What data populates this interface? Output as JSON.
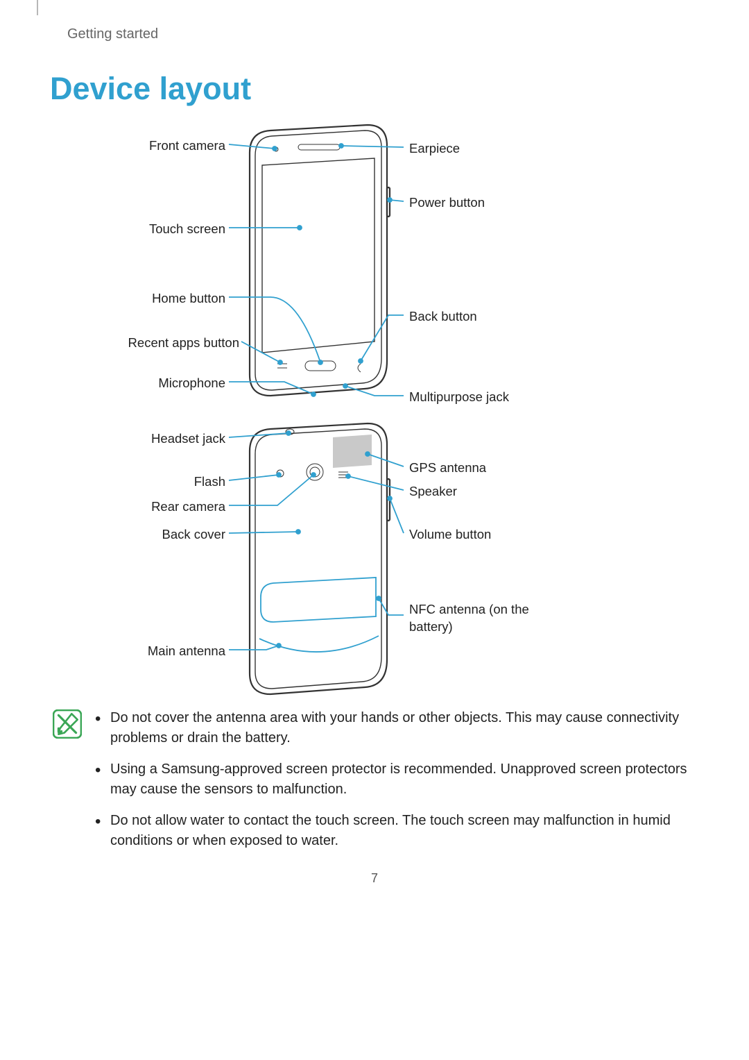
{
  "running_head": "Getting started",
  "title": "Device layout",
  "page_number": "7",
  "labels": {
    "front_camera": "Front camera",
    "touch_screen": "Touch screen",
    "home_button": "Home button",
    "recent_apps": "Recent apps button",
    "microphone": "Microphone",
    "earpiece": "Earpiece",
    "power_button": "Power button",
    "back_button": "Back button",
    "multi_jack": "Multipurpose jack",
    "headset_jack": "Headset jack",
    "flash": "Flash",
    "rear_camera": "Rear camera",
    "back_cover": "Back cover",
    "main_antenna": "Main antenna",
    "gps_antenna": "GPS antenna",
    "speaker": "Speaker",
    "volume_button": "Volume button",
    "nfc_antenna": "NFC antenna (on the battery)"
  },
  "notes": [
    "Do not cover the antenna area with your hands or other objects. This may cause connectivity problems or drain the battery.",
    "Using a Samsung-approved screen protector is recommended. Unapproved screen protectors may cause the sensors to malfunction.",
    "Do not allow water to contact the touch screen. The touch screen may malfunction in humid conditions or when exposed to water."
  ],
  "colors": {
    "accent": "#30a0cf"
  }
}
